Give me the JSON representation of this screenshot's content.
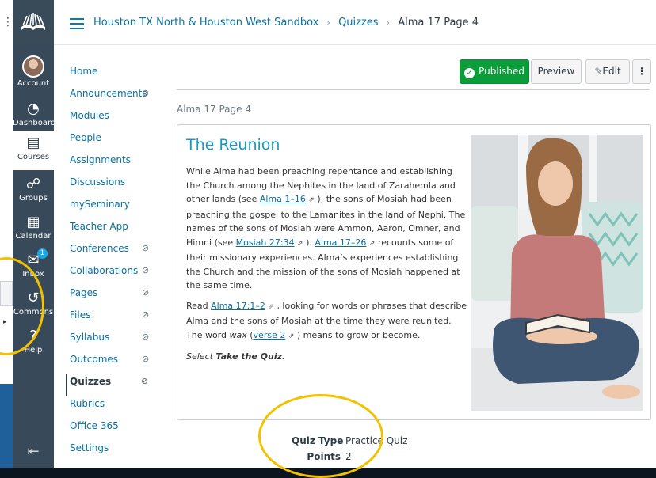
{
  "breadcrumb": {
    "course": "Houston TX North & Houston West Sandbox",
    "section": "Quizzes",
    "page": "Alma 17 Page 4"
  },
  "global_nav": [
    {
      "label": "Account",
      "icon": "account-avatar"
    },
    {
      "label": "Dashboard",
      "icon": "dashboard-icon"
    },
    {
      "label": "Courses",
      "icon": "courses-icon"
    },
    {
      "label": "Groups",
      "icon": "groups-icon"
    },
    {
      "label": "Calendar",
      "icon": "calendar-icon"
    },
    {
      "label": "Inbox",
      "icon": "inbox-icon",
      "badge": "1"
    },
    {
      "label": "Commons",
      "icon": "commons-icon"
    },
    {
      "label": "Help",
      "icon": "help-icon"
    }
  ],
  "course_nav": [
    {
      "label": "Home",
      "hidden": false
    },
    {
      "label": "Announcements",
      "hidden": true
    },
    {
      "label": "Modules",
      "hidden": false
    },
    {
      "label": "People",
      "hidden": false
    },
    {
      "label": "Assignments",
      "hidden": false
    },
    {
      "label": "Discussions",
      "hidden": false
    },
    {
      "label": "mySeminary",
      "hidden": false
    },
    {
      "label": "Teacher App",
      "hidden": false
    },
    {
      "label": "Conferences",
      "hidden": true
    },
    {
      "label": "Collaborations",
      "hidden": true
    },
    {
      "label": "Pages",
      "hidden": true
    },
    {
      "label": "Files",
      "hidden": true
    },
    {
      "label": "Syllabus",
      "hidden": true
    },
    {
      "label": "Outcomes",
      "hidden": true
    },
    {
      "label": "Quizzes",
      "hidden": true,
      "active": true
    },
    {
      "label": "Rubrics",
      "hidden": false
    },
    {
      "label": "Office 365",
      "hidden": false
    },
    {
      "label": "Settings",
      "hidden": false
    }
  ],
  "toolbar": {
    "published": "Published",
    "preview": "Preview",
    "edit": "Edit",
    "more": "⋮"
  },
  "quiz_title": "Alma 17 Page 4",
  "content": {
    "heading": "The Reunion",
    "p1": {
      "a": "While Alma had been preaching repentance and establishing the Church among the Nephites in the land of Zarahemla and other lands (see ",
      "link1": "Alma 1–16",
      "b": " ), the sons of Mosiah had been preaching the gospel to the Lamanites in the land of Nephi. The names of the sons of Mosiah were Ammon, Aaron, Omner, and Himni (see ",
      "link2": "Mosiah 27:34",
      "c": " ). ",
      "link3": "Alma 17–26",
      "d": " recounts some of their missionary experiences. Alma’s experiences establishing the Church and the mission of the sons of Mosiah happened at the same time."
    },
    "p2": {
      "a": "Read ",
      "link1": "Alma 17:1–2",
      "b": " , looking for words or phrases that describe Alma and the sons of Mosiah at the time they were reunited. The word ",
      "wax": "wax",
      "c": " (",
      "link2": "verse 2",
      "d": " ) means to grow or become."
    },
    "p3": {
      "a": "Select ",
      "b": "Take the Quiz",
      "c": "."
    }
  },
  "quiz_meta": {
    "type_label": "Quiz Type",
    "type_value": "Practice Quiz",
    "points_label": "Points",
    "points_value": "2"
  },
  "colors": {
    "nav_bg": "#384a5a",
    "link": "#0770a3",
    "heading": "#1a9ac2",
    "published": "#0b9d39",
    "highlight_circle": "#f2c200"
  }
}
